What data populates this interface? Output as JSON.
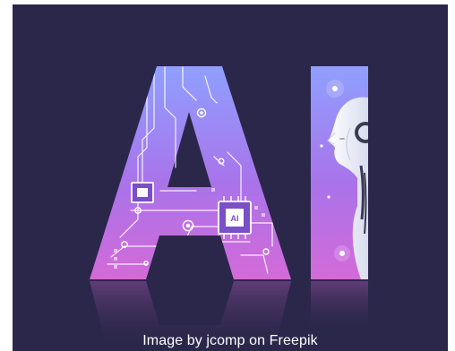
{
  "image": {
    "headline_text": "AI",
    "chip_text": "AI",
    "credit": "Image by jcomp on Freepik"
  },
  "colors": {
    "background": "#2b274a",
    "letter_gradient_top": "#8fa0ff",
    "letter_gradient_bottom": "#d46ad8",
    "circuit_line": "#ffffff",
    "robot_face": "#f3f4fb"
  }
}
